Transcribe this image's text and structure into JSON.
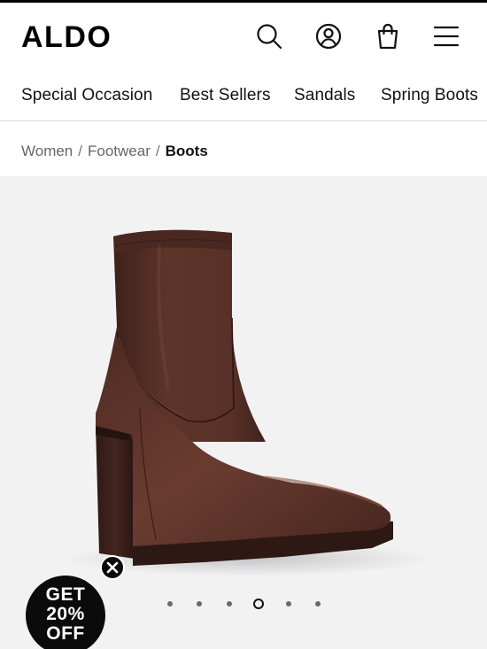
{
  "header": {
    "logo_text": "ALDO",
    "icons": [
      "search-icon",
      "account-icon",
      "shopping-bag-icon",
      "menu-icon"
    ]
  },
  "nav": {
    "items": [
      "Special Occasion",
      "Best Sellers",
      "Sandals",
      "Spring Boots"
    ]
  },
  "breadcrumb": {
    "items": [
      "Women",
      "Footwear"
    ],
    "current": "Boots",
    "separator": "/"
  },
  "gallery": {
    "image_count": 6,
    "active_index": 4
  },
  "promo": {
    "line1": "GET",
    "line2": "20%",
    "line3": "OFF"
  },
  "colors": {
    "brand": "#000000",
    "gallery_bg": "#f2f2f3",
    "boot_brown": "#5a3128"
  }
}
